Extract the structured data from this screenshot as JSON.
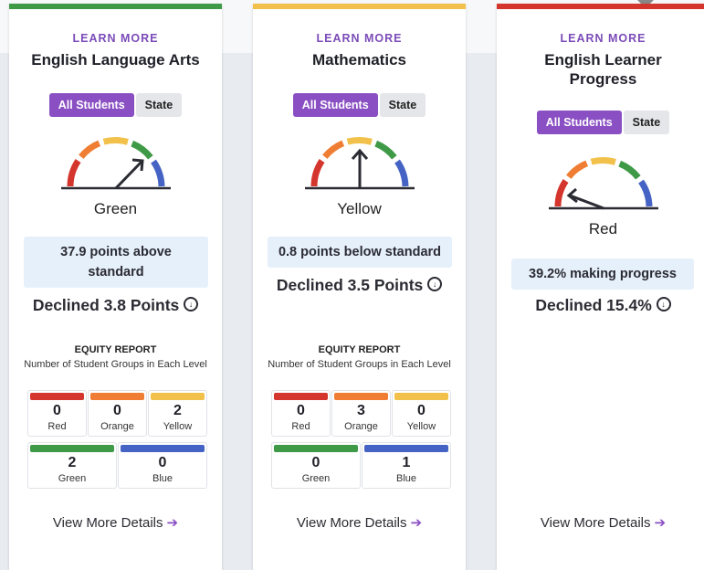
{
  "colors": {
    "red": "#d4362e",
    "orange": "#ef7d33",
    "yellow": "#f2c14b",
    "green": "#3f9a47",
    "blue": "#4563c4",
    "accent": "#8a4fc3"
  },
  "cards": [
    {
      "learn_more": "LEARN MORE",
      "title": "English Language Arts",
      "toggle": [
        "All Students",
        "State"
      ],
      "status": "Green",
      "gauge_level": "green",
      "score": "37.9 points above standard",
      "change": "Declined 3.8 Points",
      "equity": {
        "heading": "EQUITY REPORT",
        "subheading": "Number of Student Groups in Each Level",
        "levels": [
          {
            "count": "0",
            "label": "Red"
          },
          {
            "count": "0",
            "label": "Orange"
          },
          {
            "count": "2",
            "label": "Yellow"
          },
          {
            "count": "2",
            "label": "Green"
          },
          {
            "count": "0",
            "label": "Blue"
          }
        ]
      },
      "details": "View More Details"
    },
    {
      "learn_more": "LEARN MORE",
      "title": "Mathematics",
      "toggle": [
        "All Students",
        "State"
      ],
      "status": "Yellow",
      "gauge_level": "yellow",
      "score": "0.8 points below standard",
      "change": "Declined 3.5 Points",
      "equity": {
        "heading": "EQUITY REPORT",
        "subheading": "Number of Student Groups in Each Level",
        "levels": [
          {
            "count": "0",
            "label": "Red"
          },
          {
            "count": "3",
            "label": "Orange"
          },
          {
            "count": "0",
            "label": "Yellow"
          },
          {
            "count": "0",
            "label": "Green"
          },
          {
            "count": "1",
            "label": "Blue"
          }
        ]
      },
      "details": "View More Details"
    },
    {
      "learn_more": "LEARN MORE",
      "title": "English Learner Progress",
      "toggle": [
        "All Students",
        "State"
      ],
      "status": "Red",
      "gauge_level": "red",
      "score": "39.2% making progress",
      "change": "Declined 15.4%",
      "details": "View More Details"
    }
  ]
}
